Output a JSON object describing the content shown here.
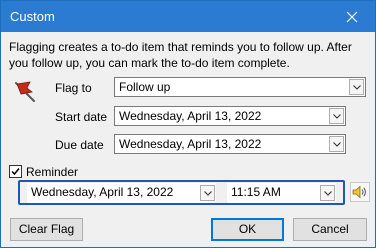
{
  "window": {
    "title": "Custom",
    "close_icon": "close-icon"
  },
  "description": "Flagging creates a to-do item that reminds you to follow up. After you follow up, you can mark the to-do item complete.",
  "flag_to": {
    "label": "Flag to",
    "value": "Follow up"
  },
  "start_date": {
    "label": "Start date",
    "value": "Wednesday, April 13, 2022"
  },
  "due_date": {
    "label": "Due date",
    "value": "Wednesday, April 13, 2022"
  },
  "reminder": {
    "label": "Reminder",
    "checked": true,
    "date": "Wednesday, April 13, 2022",
    "time": "11:15 AM",
    "sound_icon": "speaker-icon"
  },
  "buttons": {
    "clear_flag": "Clear Flag",
    "ok": "OK",
    "cancel": "Cancel"
  },
  "colors": {
    "titlebar": "#2b7bd3",
    "focus": "#1f57b8",
    "flag": "#c42b1c"
  }
}
